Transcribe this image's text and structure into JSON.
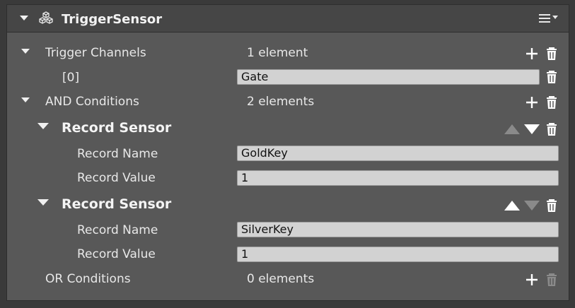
{
  "header": {
    "title": "TriggerSensor",
    "component_icon": "cube-cluster-icon",
    "menu_icon": "hamburger-menu-icon"
  },
  "trigger_channels": {
    "label": "Trigger Channels",
    "count": "1 element",
    "items": [
      {
        "index": "[0]",
        "value": "Gate"
      }
    ]
  },
  "and_conditions": {
    "label": "AND Conditions",
    "count": "2 elements",
    "items": [
      {
        "title": "Record Sensor",
        "name_label": "Record Name",
        "name_value": "GoldKey",
        "value_label": "Record Value",
        "value_value": "1"
      },
      {
        "title": "Record Sensor",
        "name_label": "Record Name",
        "name_value": "SilverKey",
        "value_label": "Record Value",
        "value_value": "1"
      }
    ]
  },
  "or_conditions": {
    "label": "OR Conditions",
    "count": "0 elements"
  },
  "colors": {
    "panel_bg": "#585858",
    "header_bg": "#464646",
    "field_bg": "#d2d2d2",
    "disabled_icon": "#8a8a8a"
  }
}
